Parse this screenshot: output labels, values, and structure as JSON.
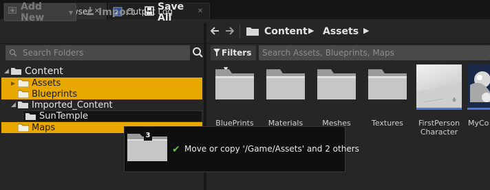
{
  "tabs": [
    {
      "label": "Content Browser",
      "close": "✕",
      "icon": "content-browser-icon"
    },
    {
      "label": "Output Log",
      "close": "✕",
      "icon": "output-log-icon"
    }
  ],
  "toolbar": {
    "add_new": "Add New",
    "import": "Import",
    "save_all": "Save All"
  },
  "breadcrumb": {
    "items": [
      "Content",
      "Assets"
    ]
  },
  "search": {
    "folders_placeholder": "Search Folders",
    "filters_label": "Filters",
    "assets_placeholder": "Search Assets, Blueprints, Maps"
  },
  "tree": {
    "root": "Content",
    "items": [
      "Assets",
      "Blueprints",
      "Imported_Content",
      "SunTemple",
      "Maps"
    ]
  },
  "assets": [
    {
      "label": "BluePrints"
    },
    {
      "label": "Materials"
    },
    {
      "label": "Meshes"
    },
    {
      "label": "Textures"
    },
    {
      "label": "FirstPerson Character"
    },
    {
      "label": "MyCo"
    }
  ],
  "drag_tooltip": {
    "count": "3",
    "message": "Move or copy '/Game/Assets' and 2 others"
  },
  "colors": {
    "selection": "#e8a800",
    "accent_blue": "#4a78e0",
    "check_green": "#6bbf3a"
  }
}
